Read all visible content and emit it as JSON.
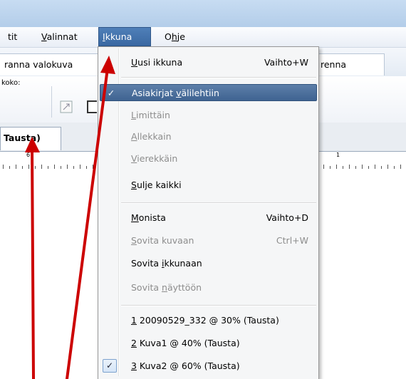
{
  "menubar": {
    "items": [
      {
        "text": "tit",
        "underline": ""
      },
      {
        "text": "alinnat",
        "underline": "V"
      },
      {
        "text": "kkuna",
        "underline": "I"
      },
      {
        "text": "hje",
        "underline": "O"
      }
    ]
  },
  "toolbar_tabs": {
    "left": "ranna valokuva",
    "right": "renna"
  },
  "ribbon": {
    "label": "koko:"
  },
  "doc_tab": {
    "label": "Tausta)"
  },
  "ruler": {
    "numbers": [
      "6",
      "1"
    ]
  },
  "dropdown": {
    "items": [
      {
        "pre": "",
        "ul": "U",
        "post": "usi ikkuna",
        "shortcut": "Vaihto+W",
        "state": "normal",
        "check": ""
      },
      {
        "pre": "Asiakirjat ",
        "ul": "v",
        "post": "älilehtiin",
        "shortcut": "",
        "state": "highlight",
        "check": "✓"
      },
      {
        "pre": "",
        "ul": "L",
        "post": "imittäin",
        "shortcut": "",
        "state": "disabled",
        "check": ""
      },
      {
        "pre": "",
        "ul": "A",
        "post": "llekkain",
        "shortcut": "",
        "state": "disabled",
        "check": ""
      },
      {
        "pre": "",
        "ul": "V",
        "post": "ierekkäin",
        "shortcut": "",
        "state": "disabled",
        "check": ""
      },
      {
        "pre": "",
        "ul": "S",
        "post": "ulje kaikki",
        "shortcut": "",
        "state": "normal",
        "check": ""
      },
      {
        "pre": "",
        "ul": "M",
        "post": "onista",
        "shortcut": "Vaihto+D",
        "state": "normal",
        "check": ""
      },
      {
        "pre": "",
        "ul": "S",
        "post": "ovita kuvaan",
        "shortcut": "Ctrl+W",
        "state": "disabled",
        "check": ""
      },
      {
        "pre": "Sovita ",
        "ul": "i",
        "post": "kkunaan",
        "shortcut": "",
        "state": "normal",
        "check": ""
      },
      {
        "pre": "Sovita ",
        "ul": "n",
        "post": "äyttöön",
        "shortcut": "",
        "state": "disabled",
        "check": ""
      },
      {
        "pre": "",
        "ul": "1",
        "post": " 20090529_332 @ 30% (Tausta)",
        "shortcut": "",
        "state": "normal",
        "check": ""
      },
      {
        "pre": "",
        "ul": "2",
        "post": " Kuva1 @ 40% (Tausta)",
        "shortcut": "",
        "state": "normal",
        "check": ""
      },
      {
        "pre": "",
        "ul": "3",
        "post": " Kuva2 @ 60% (Tausta)",
        "shortcut": "",
        "state": "normal",
        "check": "✓"
      }
    ]
  },
  "colors": {
    "highlight": "#4a6e9c",
    "annotation_arrow": "#cc0000"
  }
}
